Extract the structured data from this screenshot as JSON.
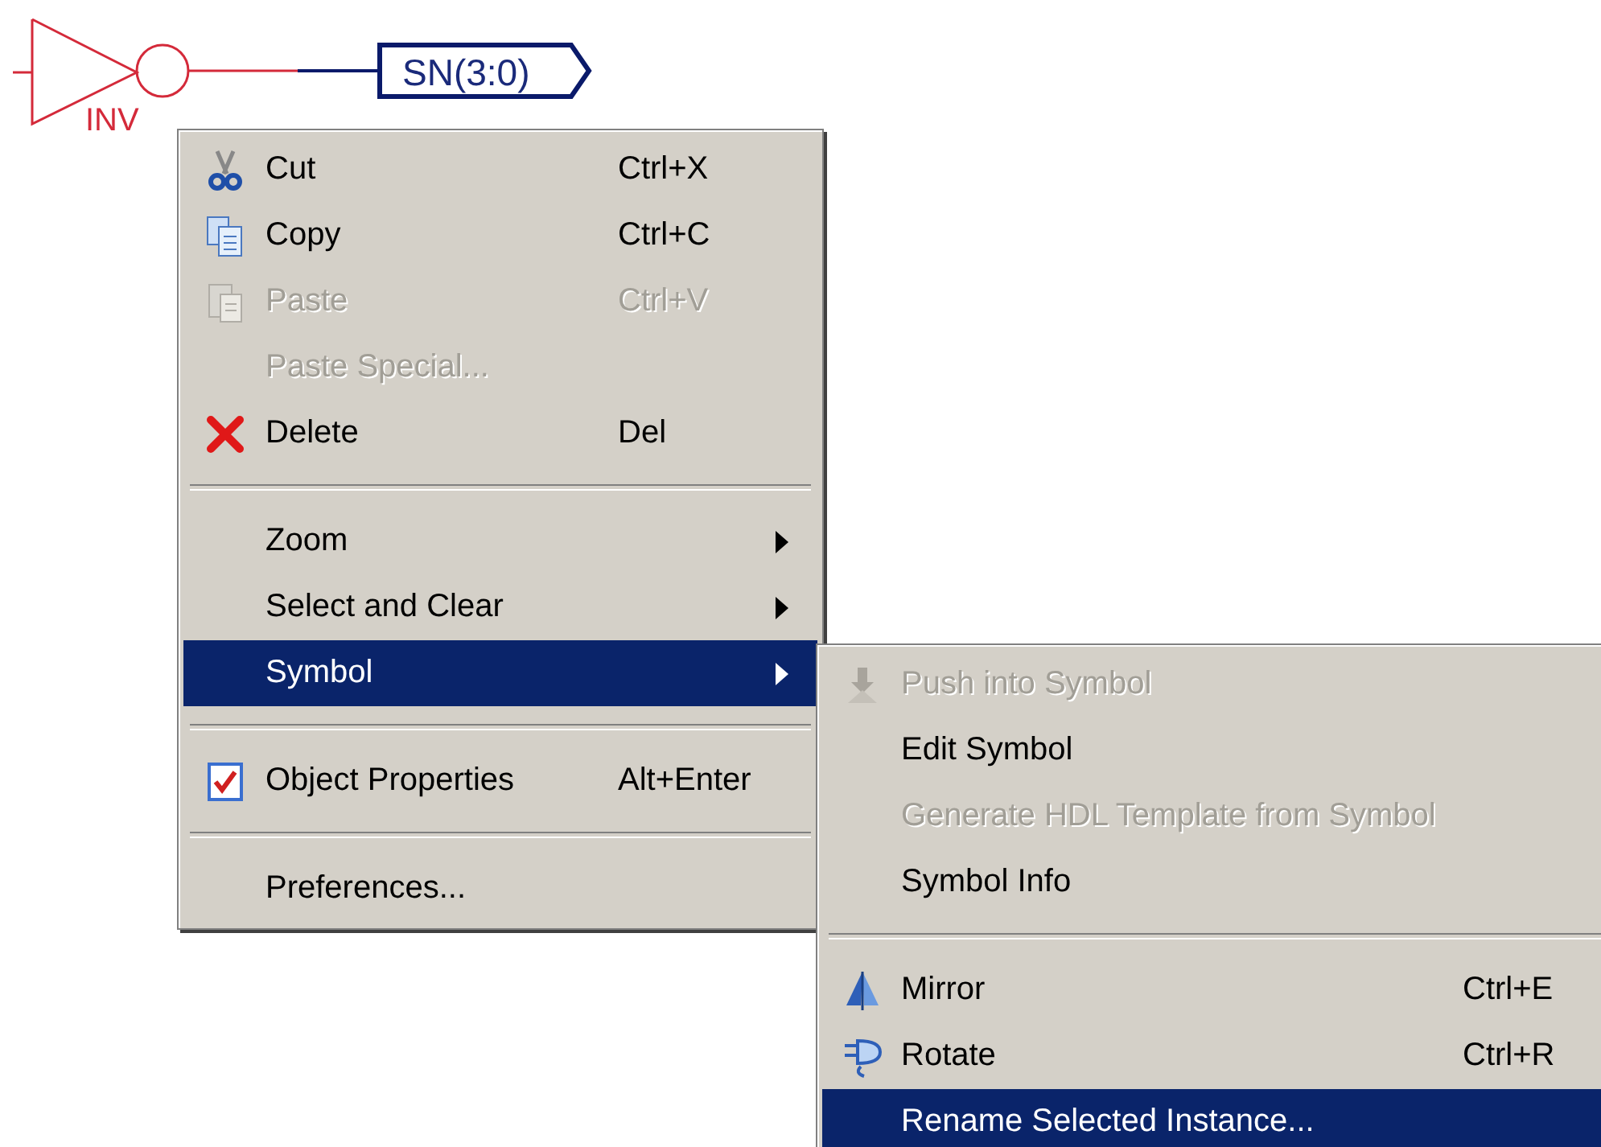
{
  "schematic": {
    "gate_label": "INV",
    "net_label": "SN(3:0)"
  },
  "context_menu": {
    "items": [
      {
        "kind": "item",
        "label": "Cut",
        "shortcut": "Ctrl+X",
        "disabled": false,
        "selected": false,
        "submenu": false
      },
      {
        "kind": "item",
        "label": "Copy",
        "shortcut": "Ctrl+C",
        "disabled": false,
        "selected": false,
        "submenu": false
      },
      {
        "kind": "item",
        "label": "Paste",
        "shortcut": "Ctrl+V",
        "disabled": true,
        "selected": false,
        "submenu": false
      },
      {
        "kind": "item",
        "label": "Paste Special...",
        "disabled": true,
        "selected": false,
        "submenu": false
      },
      {
        "kind": "item",
        "label": "Delete",
        "shortcut": "Del",
        "disabled": false,
        "selected": false,
        "submenu": false
      },
      {
        "kind": "separator"
      },
      {
        "kind": "item",
        "label": "Zoom",
        "disabled": false,
        "selected": false,
        "submenu": true
      },
      {
        "kind": "item",
        "label": "Select and Clear",
        "disabled": false,
        "selected": false,
        "submenu": true
      },
      {
        "kind": "item",
        "label": "Symbol",
        "disabled": false,
        "selected": true,
        "submenu": true
      },
      {
        "kind": "separator"
      },
      {
        "kind": "item",
        "label": "Object Properties",
        "shortcut": "Alt+Enter",
        "disabled": false,
        "selected": false,
        "submenu": false
      },
      {
        "kind": "separator"
      },
      {
        "kind": "item",
        "label": "Preferences...",
        "disabled": false,
        "selected": false,
        "submenu": false
      }
    ]
  },
  "submenu": {
    "items": [
      {
        "kind": "item",
        "label": "Push into Symbol",
        "disabled": true,
        "selected": false,
        "submenu": false
      },
      {
        "kind": "item",
        "label": "Edit Symbol",
        "disabled": false,
        "selected": false,
        "submenu": false
      },
      {
        "kind": "item",
        "label": "Generate HDL Template from Symbol",
        "disabled": true,
        "selected": false,
        "submenu": false
      },
      {
        "kind": "item",
        "label": "Symbol Info",
        "disabled": false,
        "selected": false,
        "submenu": false
      },
      {
        "kind": "separator"
      },
      {
        "kind": "item",
        "label": "Mirror",
        "shortcut": "Ctrl+E",
        "disabled": false,
        "selected": false,
        "submenu": false
      },
      {
        "kind": "item",
        "label": "Rotate",
        "shortcut": "Ctrl+R",
        "disabled": false,
        "selected": false,
        "submenu": false
      },
      {
        "kind": "item",
        "label": "Rename Selected Instance...",
        "disabled": false,
        "selected": true,
        "submenu": false
      }
    ]
  }
}
